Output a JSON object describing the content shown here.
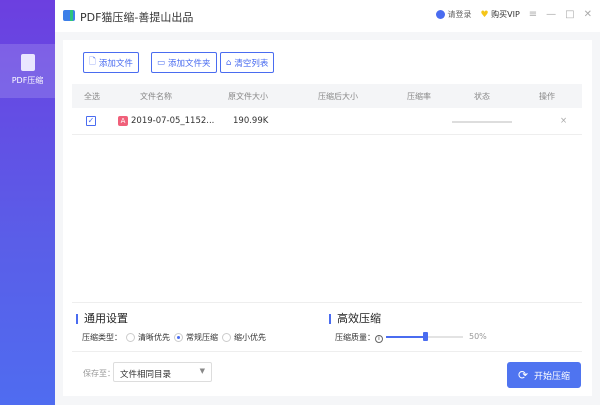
{
  "sidebar": {
    "items": [
      {
        "label": "PDF压缩",
        "icon": "pdf-compress-icon",
        "active": true
      }
    ]
  },
  "titlebar": {
    "title": "PDF猫压缩-善提山出品",
    "login": "请登录",
    "vip": "购买VIP"
  },
  "toolbar": {
    "add_file": "添加文件",
    "add_folder": "添加文件夹",
    "clear_list": "清空列表"
  },
  "table": {
    "headers": [
      "全选",
      "文件名称",
      "原文件大小",
      "压缩后大小",
      "压缩率",
      "状态",
      "操作"
    ],
    "rows": [
      {
        "checked": true,
        "name": "2019-07-05_1152...",
        "original_size": "190.99K",
        "compressed_size": "",
        "ratio": "",
        "status": "",
        "action": "×"
      }
    ]
  },
  "settings": {
    "general_title": "通用设置",
    "type_label": "压缩类型：",
    "options": [
      "清晰优先",
      "常规压缩",
      "缩小优先"
    ],
    "selected": "常规压缩",
    "efficient_title": "高效压缩",
    "quality_label": "压缩质量：",
    "quality_percent": 50,
    "quality_text": "50%"
  },
  "footer": {
    "save_label": "保存至：",
    "save_value": "文件相同目录",
    "start_label": "开始压缩"
  },
  "colors": {
    "accent": "#4a6cf0",
    "sidebar_top": "#6c3fe0",
    "sidebar_bottom": "#4f6cf0"
  }
}
